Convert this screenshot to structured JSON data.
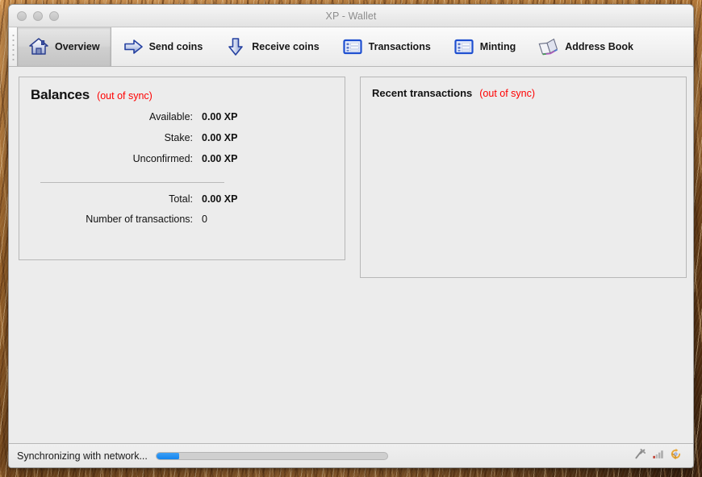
{
  "window": {
    "title": "XP - Wallet",
    "traffic_lights": [
      "close-button",
      "minimize-button",
      "zoom-button"
    ]
  },
  "toolbar": {
    "items": [
      {
        "label": "Overview",
        "icon": "home-icon",
        "selected": true
      },
      {
        "label": "Send coins",
        "icon": "arrow-right-icon",
        "selected": false
      },
      {
        "label": "Receive coins",
        "icon": "arrow-down-icon",
        "selected": false
      },
      {
        "label": "Transactions",
        "icon": "list-icon",
        "selected": false
      },
      {
        "label": "Minting",
        "icon": "list-icon",
        "selected": false
      },
      {
        "label": "Address Book",
        "icon": "book-icon",
        "selected": false
      }
    ]
  },
  "balances": {
    "title": "Balances",
    "sync_note": "(out of sync)",
    "rows": [
      {
        "label": "Available:",
        "value": "0.00 XP"
      },
      {
        "label": "Stake:",
        "value": "0.00 XP"
      },
      {
        "label": "Unconfirmed:",
        "value": "0.00 XP"
      }
    ],
    "total": {
      "label": "Total:",
      "value": "0.00 XP"
    },
    "tx_count": {
      "label": "Number of transactions:",
      "value": "0"
    }
  },
  "recent_transactions": {
    "title": "Recent transactions",
    "sync_note": "(out of sync)",
    "items": []
  },
  "statusbar": {
    "text": "Synchronizing with network...",
    "progress_percent": 10,
    "icons": [
      "mining-hammer-icon",
      "signal-bars-icon",
      "sync-refresh-icon"
    ]
  },
  "colors": {
    "accent_blue": "#1284ef",
    "sync_red": "#ff0000",
    "window_bg": "#ececec",
    "panel_border": "#b7b7b7",
    "title_text": "#8d8d8d"
  }
}
